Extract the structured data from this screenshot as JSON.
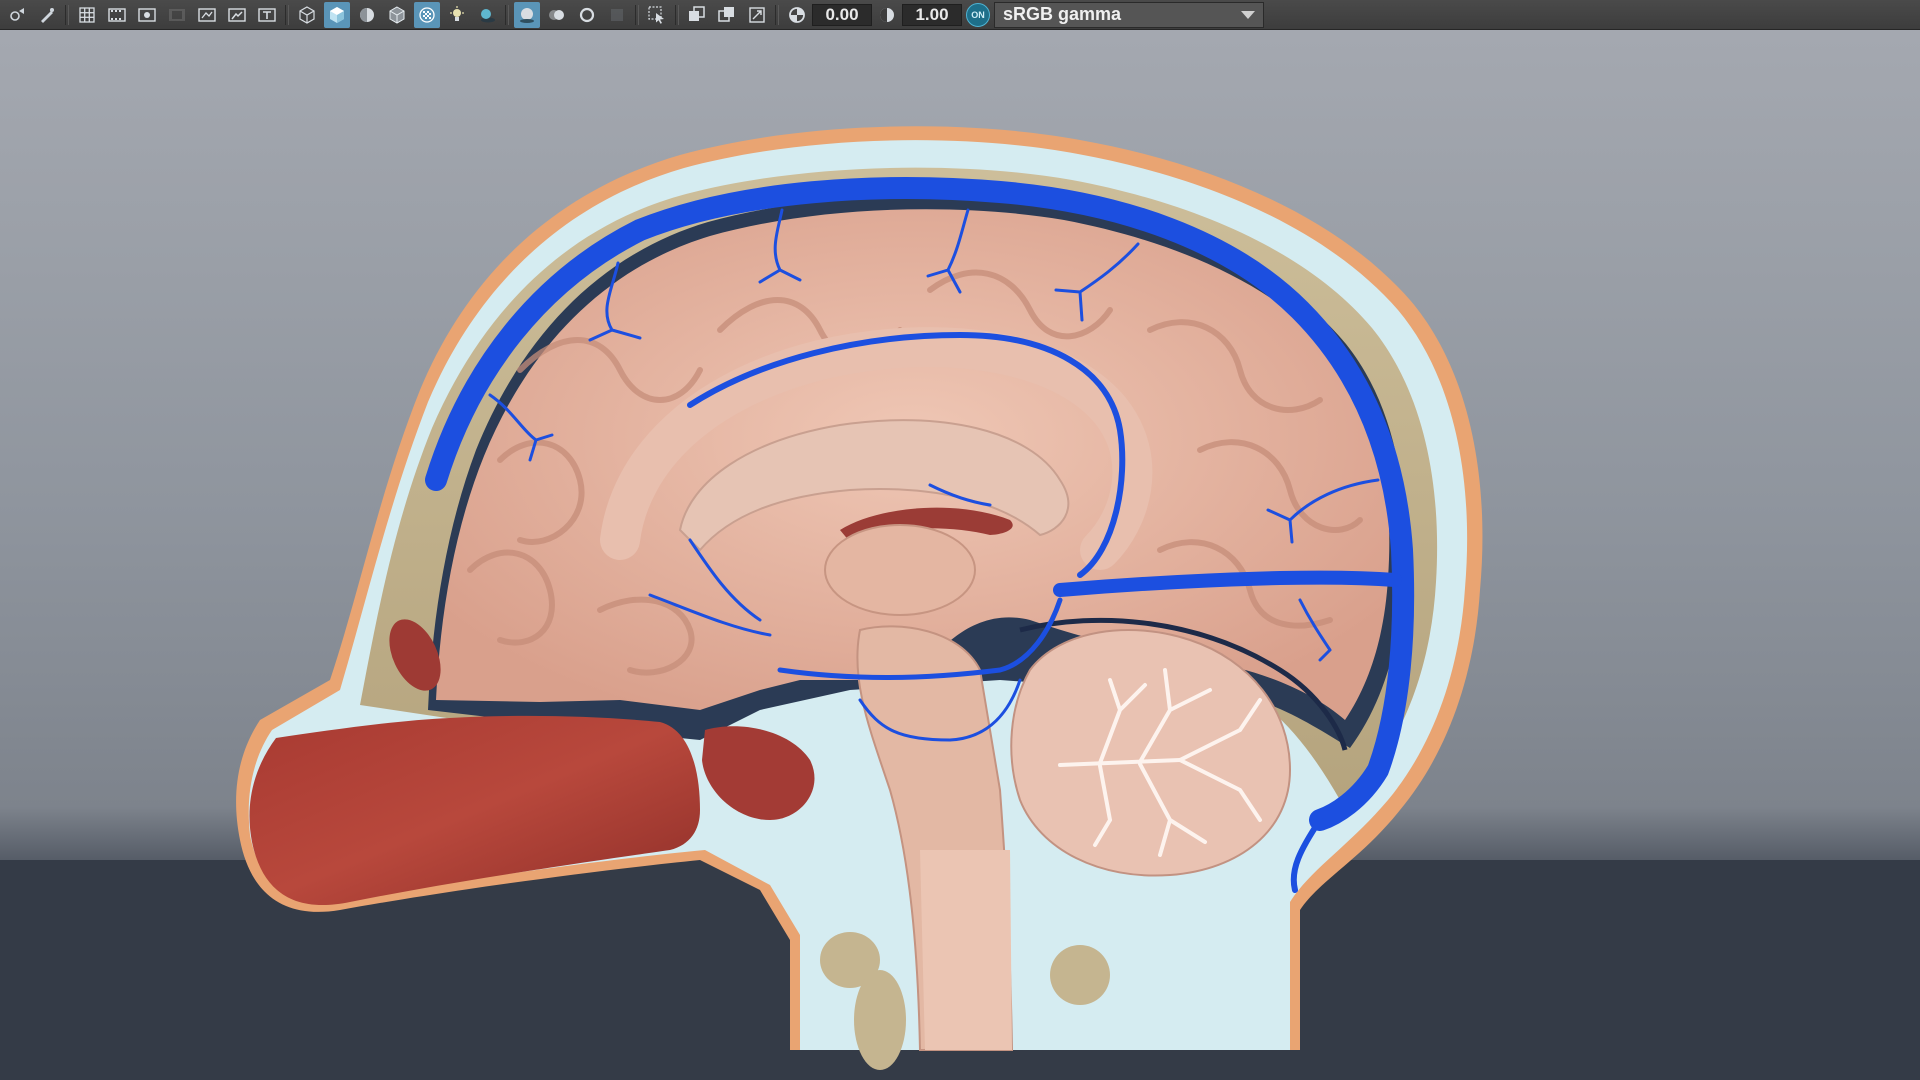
{
  "toolbar": {
    "exposure_value": "0.00",
    "gamma_value": "1.00",
    "color_management_toggle": "ON",
    "color_space_label": "sRGB gamma",
    "icons": [
      "select-camera-icon",
      "camera-attributes-icon",
      "grid-icon",
      "film-gate-icon",
      "resolution-gate-icon",
      "gate-mask-icon",
      "field-chart-icon",
      "safe-action-icon",
      "safe-title-icon",
      "wireframe-icon",
      "smooth-shade-icon",
      "default-material-icon",
      "wireframe-on-shaded-icon",
      "xray-icon",
      "use-lights-icon",
      "shadows-icon",
      "screen-space-ao-icon",
      "motion-blur-icon",
      "anti-aliasing-icon",
      "depth-of-field-icon",
      "isolate-select-icon",
      "xray-joints-icon",
      "xray-active-components-icon",
      "image-plane-icon",
      "exposure-icon",
      "gamma-icon"
    ]
  },
  "colors": {
    "toolbar_bg": "#3d3d3d",
    "active_button": "#5a95b8",
    "vein_blue": "#1c4fe0",
    "brain_tissue": "#e9b9a6",
    "muscle_red": "#b4443a",
    "bone_beige": "#c9b893",
    "csf_light_blue": "#d4ecf0",
    "skin_orange": "#e5a376"
  }
}
